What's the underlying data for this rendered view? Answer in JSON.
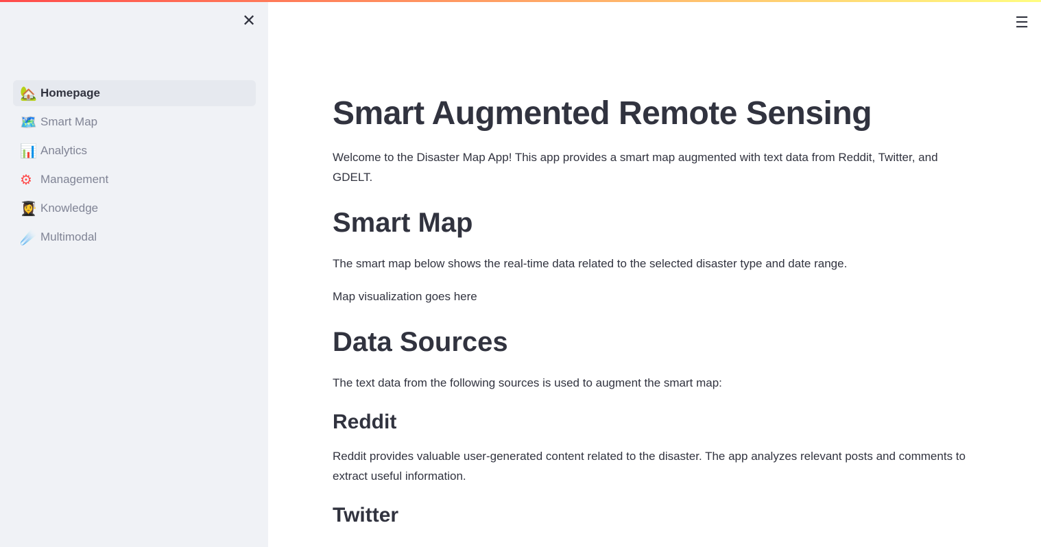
{
  "sidebar": {
    "close_icon": "close-icon",
    "items": [
      {
        "label": "Homepage",
        "icon": "🏡",
        "active": true
      },
      {
        "label": "Smart Map",
        "icon": "🗺️"
      },
      {
        "label": "Analytics",
        "icon": "📊"
      },
      {
        "label": "Management",
        "icon": "⚙"
      },
      {
        "label": "Knowledge",
        "icon": "👩‍🎓"
      },
      {
        "label": "Multimodal",
        "icon": "☄️"
      }
    ]
  },
  "header": {
    "menu_icon": "hamburger-icon"
  },
  "main": {
    "title": "Smart Augmented Remote Sensing",
    "intro": "Welcome to the Disaster Map App! This app provides a smart map augmented with text data from Reddit, Twitter, and GDELT.",
    "smart_map": {
      "heading": "Smart Map",
      "text": "The smart map below shows the real-time data related to the selected disaster type and date range.",
      "placeholder": "Map visualization goes here"
    },
    "data_sources": {
      "heading": "Data Sources",
      "text": "The text data from the following sources is used to augment the smart map:"
    },
    "reddit": {
      "heading": "Reddit",
      "text": "Reddit provides valuable user-generated content related to the disaster. The app analyzes relevant posts and comments to extract useful information."
    },
    "twitter": {
      "heading": "Twitter"
    }
  },
  "colors": {
    "accent_gradient_start": "#ff4b4b",
    "accent_gradient_end": "#fffd80",
    "sidebar_bg": "#f0f2f6"
  }
}
